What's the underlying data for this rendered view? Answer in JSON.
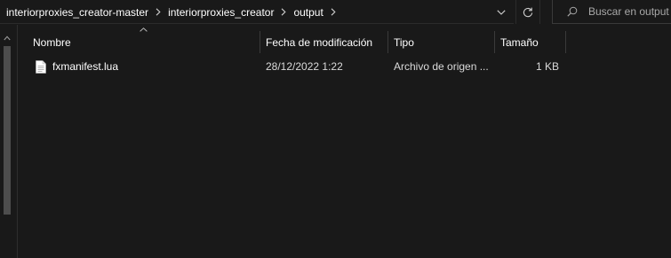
{
  "breadcrumbs": [
    {
      "label": "interiorproxies_creator-master"
    },
    {
      "label": "interiorproxies_creator"
    },
    {
      "label": "output"
    }
  ],
  "search": {
    "placeholder": "Buscar en output",
    "value": ""
  },
  "columns": {
    "name": "Nombre",
    "modified": "Fecha de modificación",
    "type": "Tipo",
    "size": "Tamaño"
  },
  "files": [
    {
      "name": "fxmanifest.lua",
      "modified": "28/12/2022 1:22",
      "type": "Archivo de origen ...",
      "size": "1 KB",
      "icon": "text-file-icon"
    }
  ],
  "colors": {
    "background": "#191919",
    "text": "#ffffff",
    "divider": "#3a3a3a",
    "scrollbar_thumb": "#4d4d4d"
  }
}
